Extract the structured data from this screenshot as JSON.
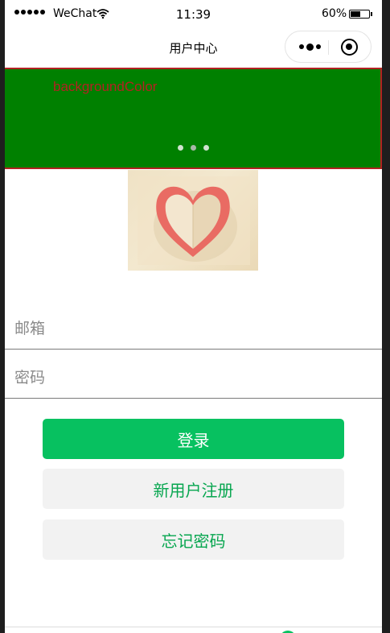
{
  "status_bar": {
    "carrier": "WeChat",
    "time": "11:39",
    "battery": "60%",
    "battery_level": 0.6,
    "signal_icon": "signal-dots-icon",
    "wifi_icon": "wifi-icon",
    "battery_icon": "battery-icon"
  },
  "nav": {
    "title": "用户中心",
    "more_icon": "more-dots-icon",
    "close_icon": "target-circle-icon"
  },
  "swiper": {
    "text": "backgroundColor",
    "background": "#008000",
    "border_color": "#b22222",
    "dot_count": 3,
    "active_dot": 2
  },
  "image": {
    "icon": "paper-heart-image"
  },
  "form": {
    "email_placeholder": "邮箱",
    "password_placeholder": "密码"
  },
  "buttons": {
    "login": "登录",
    "register": "新用户注册",
    "forgot": "忘记密码"
  },
  "colors": {
    "primary": "#07c160",
    "secondary_bg": "#f2f2f2",
    "secondary_text": "#07a64f"
  }
}
